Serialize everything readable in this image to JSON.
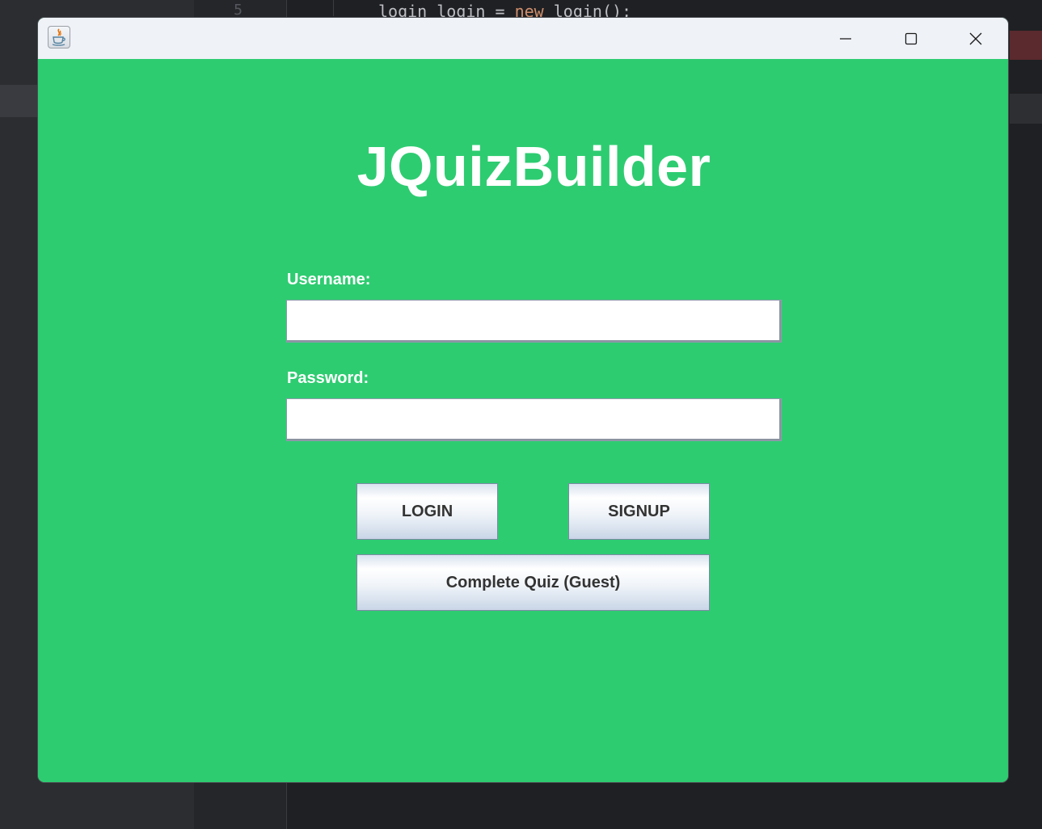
{
  "background_ide": {
    "line_number": "5",
    "code_keyword": "new",
    "code_prefix": "login login = ",
    "code_suffix": " login();"
  },
  "window": {
    "app_icon": "java-coffee-icon",
    "controls": {
      "minimize": "minimize-icon",
      "maximize": "maximize-icon",
      "close": "close-icon"
    }
  },
  "login_form": {
    "title": "JQuizBuilder",
    "username_label": "Username:",
    "username_value": "",
    "password_label": "Password:",
    "password_value": "",
    "login_button": "LOGIN",
    "signup_button": "SIGNUP",
    "guest_button": "Complete Quiz (Guest)"
  },
  "colors": {
    "panel_background": "#2ecc71",
    "title_text": "#ffffff",
    "titlebar": "#eff2f7",
    "button_text": "#333333"
  }
}
